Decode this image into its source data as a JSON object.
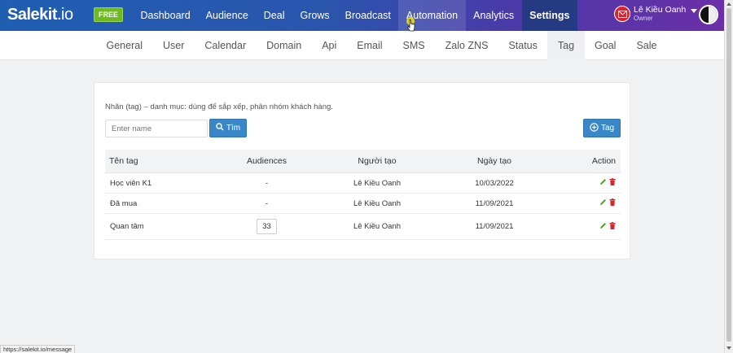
{
  "header": {
    "logo_main": "Salekit",
    "logo_suffix": ".io",
    "badge": "FREE",
    "nav": [
      {
        "label": "Dashboard"
      },
      {
        "label": "Audience"
      },
      {
        "label": "Deal"
      },
      {
        "label": "Grows"
      },
      {
        "label": "Broadcast"
      },
      {
        "label": "Automation"
      },
      {
        "label": "Analytics"
      },
      {
        "label": "Settings"
      }
    ],
    "user": {
      "name": "Lê Kiều Oanh",
      "role": "Owner"
    }
  },
  "subnav": {
    "items": [
      {
        "label": "General"
      },
      {
        "label": "User"
      },
      {
        "label": "Calendar"
      },
      {
        "label": "Domain"
      },
      {
        "label": "Api"
      },
      {
        "label": "Email"
      },
      {
        "label": "SMS"
      },
      {
        "label": "Zalo ZNS"
      },
      {
        "label": "Status"
      },
      {
        "label": "Tag"
      },
      {
        "label": "Goal"
      },
      {
        "label": "Sale"
      }
    ],
    "active": "Tag"
  },
  "tag_panel": {
    "description": "Nhãn (tag) – danh mục: dùng để sắp xếp, phân nhóm khách hàng.",
    "search_placeholder": "Enter name",
    "search_button": "Tìm",
    "add_button": "Tag",
    "columns": [
      "Tên tag",
      "Audiences",
      "Người tạo",
      "Ngày tạo",
      "Action"
    ],
    "rows": [
      {
        "name": "Học viên K1",
        "audiences": "-",
        "creator": "Lê Kiều Oanh",
        "date": "10/03/2022"
      },
      {
        "name": "Đã mua",
        "audiences": "-",
        "creator": "Lê Kiều Oanh",
        "date": "11/09/2021"
      },
      {
        "name": "Quan tâm",
        "audiences": "33",
        "creator": "Lê Kiều Oanh",
        "date": "11/09/2021"
      }
    ]
  },
  "statusbar": {
    "url": "https://salekit.io/message"
  },
  "colors": {
    "primary_button": "#3a87c8",
    "badge_green": "#6dbb1f",
    "edit_icon": "#5aa02c",
    "delete_icon": "#d9252f"
  }
}
